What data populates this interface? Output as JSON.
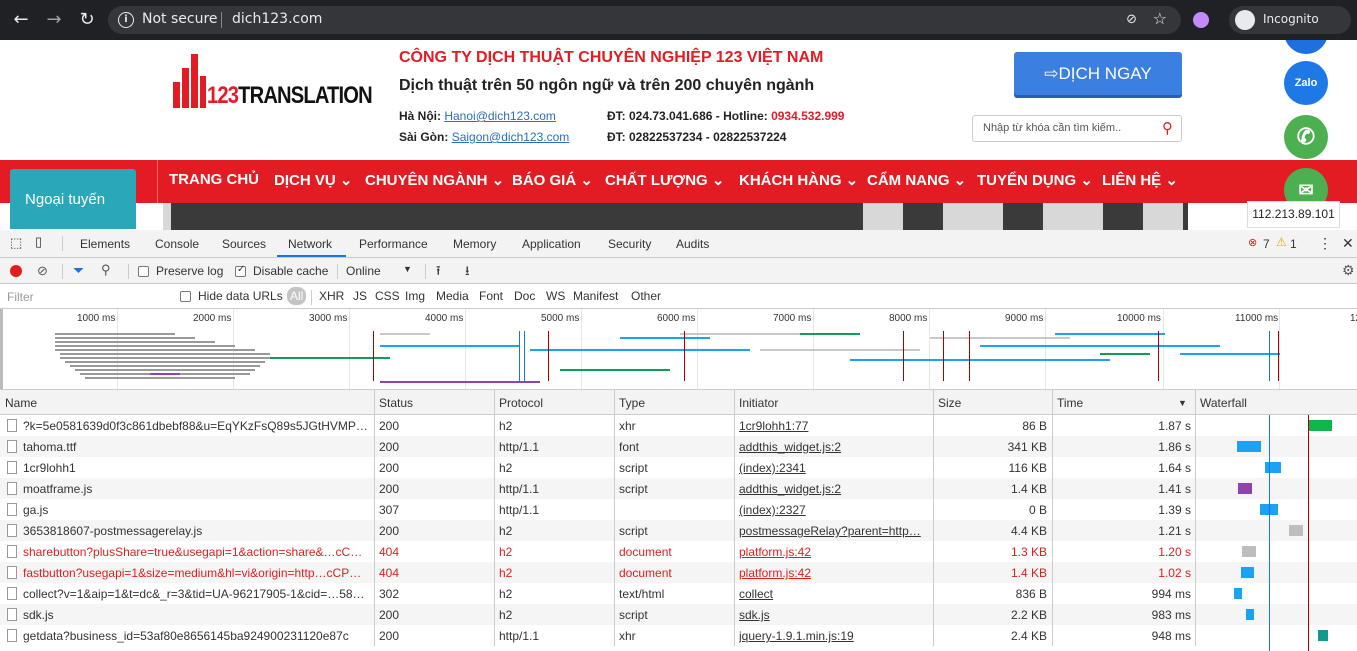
{
  "browser": {
    "security_label": "Not secure",
    "url": "dich123.com",
    "profile_label": "Incognito"
  },
  "site": {
    "logo_text_red": "123",
    "logo_text_black": "TRANSLATION",
    "company": "CÔNG TY DỊCH THUẬT CHUYÊN NGHIỆP 123 VIỆT NAM",
    "tagline": "Dịch thuật trên 50 ngôn ngữ và trên 200 chuyên ngành",
    "hanoi_label": "Hà Nội:",
    "hanoi_email": "Hanoi@dich123.com",
    "saigon_label": "Sài Gòn:",
    "saigon_email": "Saigon@dich123.com",
    "phone_hn": "ĐT: 024.73.041.686 - Hotline:",
    "hotline": "0934.532.999",
    "phone_sg": "ĐT: 02822537234 - 02822537224",
    "cta": "DỊCH NGAY",
    "search_placeholder": "Nhập từ khóa cần tìm kiếm..",
    "offline": "Ngoại tuyến",
    "ip": "112.213.89.101",
    "zalo": "Zalo",
    "nav": [
      "TRANG CHỦ",
      "DỊCH VỤ",
      "CHUYÊN NGÀNH",
      "BÁO GIÁ",
      "CHẤT LƯỢNG",
      "KHÁCH HÀNG",
      "CẨM NANG",
      "TUYỂN DỤNG",
      "LIÊN HỆ"
    ]
  },
  "devtools": {
    "tabs": [
      "Elements",
      "Console",
      "Sources",
      "Network",
      "Performance",
      "Memory",
      "Application",
      "Security",
      "Audits"
    ],
    "active_tab": "Network",
    "errors": "7",
    "warnings": "1",
    "preserve_log": "Preserve log",
    "disable_cache": "Disable cache",
    "throttle": "Online",
    "filter_placeholder": "Filter",
    "hide_data_urls": "Hide data URLs",
    "types": [
      "All",
      "XHR",
      "JS",
      "CSS",
      "Img",
      "Media",
      "Font",
      "Doc",
      "WS",
      "Manifest",
      "Other"
    ],
    "ticks": [
      "1000 ms",
      "2000 ms",
      "3000 ms",
      "4000 ms",
      "5000 ms",
      "6000 ms",
      "7000 ms",
      "8000 ms",
      "9000 ms",
      "10000 ms",
      "11000 ms",
      "12"
    ],
    "columns": [
      "Name",
      "Status",
      "Protocol",
      "Type",
      "Initiator",
      "Size",
      "Time",
      "Waterfall"
    ],
    "requests": [
      {
        "name": "?k=5e0581639d0f3c861dbebf88&u=EqYKzFsQ89s5JGtHVMP…",
        "status": "200",
        "protocol": "h2",
        "type": "xhr",
        "initiator": "1cr9lohh1:77",
        "size": "86 B",
        "time": "1.87 s",
        "error": false
      },
      {
        "name": "tahoma.ttf",
        "status": "200",
        "protocol": "http/1.1",
        "type": "font",
        "initiator": "addthis_widget.js:2",
        "size": "341 KB",
        "time": "1.86 s",
        "error": false
      },
      {
        "name": "1cr9lohh1",
        "status": "200",
        "protocol": "h2",
        "type": "script",
        "initiator": "(index):2341",
        "size": "116 KB",
        "time": "1.64 s",
        "error": false
      },
      {
        "name": "moatframe.js",
        "status": "200",
        "protocol": "http/1.1",
        "type": "script",
        "initiator": "addthis_widget.js:2",
        "size": "1.4 KB",
        "time": "1.41 s",
        "error": false
      },
      {
        "name": "ga.js",
        "status": "307",
        "protocol": "http/1.1",
        "type": "",
        "initiator": "(index):2327",
        "size": "0 B",
        "time": "1.39 s",
        "error": false
      },
      {
        "name": "3653818607-postmessagerelay.js",
        "status": "200",
        "protocol": "h2",
        "type": "script",
        "initiator": "postmessageRelay?parent=http…",
        "size": "4.4 KB",
        "time": "1.21 s",
        "error": false
      },
      {
        "name": "sharebutton?plusShare=true&usegapi=1&action=share&…cC…",
        "status": "404",
        "protocol": "h2",
        "type": "document",
        "initiator": "platform.js:42",
        "size": "1.3 KB",
        "time": "1.20 s",
        "error": true
      },
      {
        "name": "fastbutton?usegapi=1&size=medium&hl=vi&origin=http…cCP…",
        "status": "404",
        "protocol": "h2",
        "type": "document",
        "initiator": "platform.js:42",
        "size": "1.4 KB",
        "time": "1.02 s",
        "error": true
      },
      {
        "name": "collect?v=1&aip=1&t=dc&_r=3&tid=UA-96217905-1&cid=…58…",
        "status": "302",
        "protocol": "h2",
        "type": "text/html",
        "initiator": "collect",
        "size": "836 B",
        "time": "994 ms",
        "error": false
      },
      {
        "name": "sdk.js",
        "status": "200",
        "protocol": "h2",
        "type": "script",
        "initiator": "sdk.js",
        "size": "2.2 KB",
        "time": "983 ms",
        "error": false
      },
      {
        "name": "getdata?business_id=53af80e8656145ba924900231120e87c",
        "status": "200",
        "protocol": "http/1.1",
        "type": "xhr",
        "initiator": "jquery-1.9.1.min.js:19",
        "size": "2.4 KB",
        "time": "948 ms",
        "error": false
      }
    ]
  },
  "colors": {
    "brand_red": "#e31c24",
    "cta_blue": "#3b7fe0",
    "devtools_blue": "#1a73e8",
    "error_red": "#e01e1e"
  }
}
